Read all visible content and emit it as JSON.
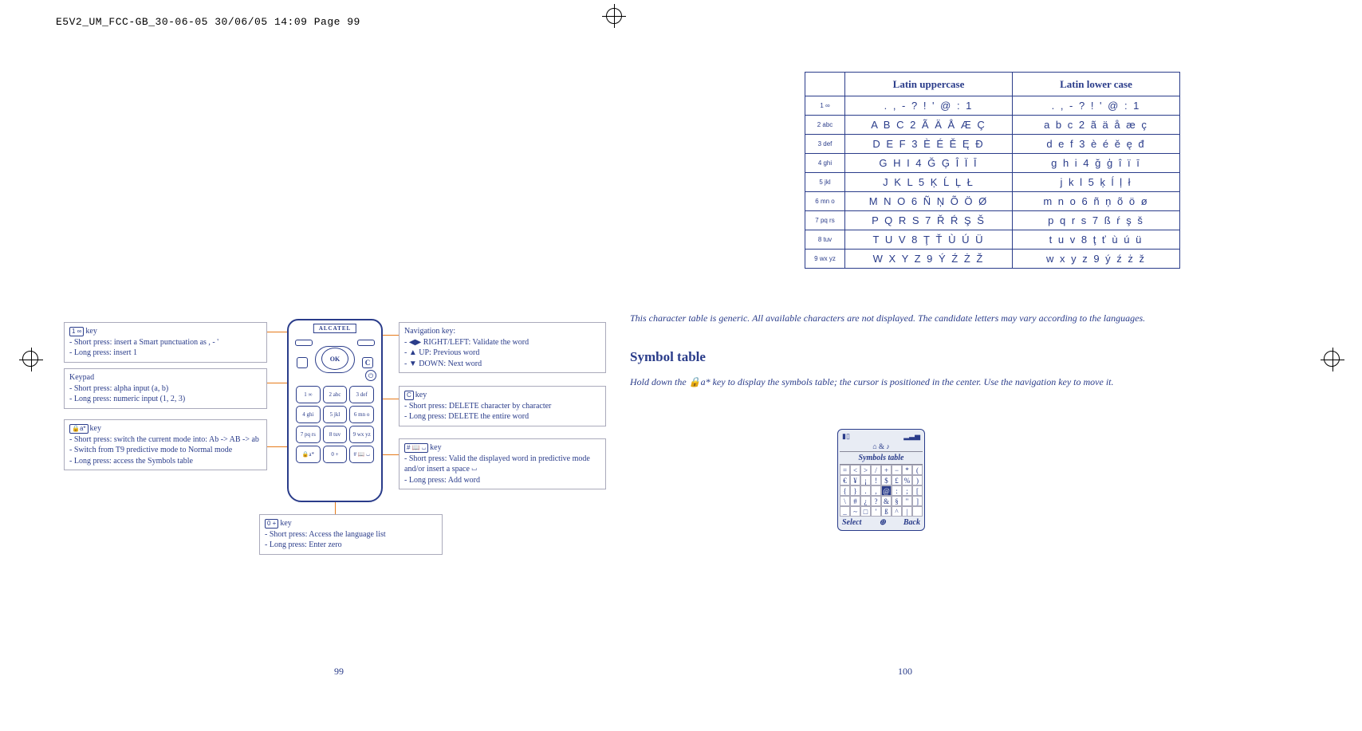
{
  "header": "E5V2_UM_FCC-GB_30-06-05  30/06/05  14:09  Page 99",
  "left_page": {
    "page_num": "99",
    "phone_brand": "ALCATEL",
    "ok_label": "OK",
    "c_label": "C",
    "end_label": "⏻",
    "keys": [
      "1 ∞",
      "2 abc",
      "3 def",
      "4 ghi",
      "5 jkl",
      "6 mn o",
      "7 pq rs",
      "8 tuv",
      "9 wx yz",
      "🔒a*",
      "0 +",
      "# 📖 ⏘"
    ],
    "c1": {
      "t": "key",
      "kg": "1 ∞",
      "l1": "Short press: insert a Smart punctuation as , - '",
      "l2": "Long press: insert 1"
    },
    "c2": {
      "t": "Keypad",
      "l1": "Short press: alpha input (a, b)",
      "l2": "Long press: numeric input (1, 2, 3)"
    },
    "c3": {
      "t": "key",
      "kg": "🔒a*",
      "l1": "Short press: switch the current mode into: Ab -> AB -> ab",
      "l2": "Switch from T9 predictive mode to Normal mode",
      "l3": "Long press: access the Symbols table"
    },
    "cr1": {
      "t": "Navigation key:",
      "l1": "◀▶ RIGHT/LEFT: Validate the word",
      "l2": "▲ UP: Previous word",
      "l3": "▼ DOWN: Next word"
    },
    "cr2": {
      "t": "key",
      "kg": "C",
      "l1": "Short press: DELETE character by character",
      "l2": "Long press: DELETE the entire word"
    },
    "cr3": {
      "t": "key",
      "kg": "# 📖 ⏘",
      "l1": "Short press: Valid the displayed word in predictive mode and/or insert a space ⏘",
      "l2": "Long press: Add word"
    },
    "cb": {
      "t": "key",
      "kg": "0 +",
      "l1": "Short press: Access the language list",
      "l2": "Long press: Enter zero"
    }
  },
  "right_page": {
    "page_num": "100",
    "th1": "Latin uppercase",
    "th2": "Latin lower case",
    "rows": [
      {
        "k": "1 ∞",
        "u": ". , - ? ! ' @ : 1",
        "l": ". , - ? ! ' @ : 1"
      },
      {
        "k": "2 abc",
        "u": "A B C 2 Ã Ä Å Æ Ç",
        "l": "a b c 2 ã ä å æ ç"
      },
      {
        "k": "3 def",
        "u": "D E F 3 È É Ě Ę Đ",
        "l": "d e f 3 è é ě ę đ"
      },
      {
        "k": "4 ghi",
        "u": "G H I 4 Ğ Ģ Î Ï Ī",
        "l": "g h i 4 ğ ģ î ï ī"
      },
      {
        "k": "5 jkl",
        "u": "J K L 5 Ķ Ĺ Ļ Ł",
        "l": "j k l 5 ķ ĺ ļ ł"
      },
      {
        "k": "6 mn o",
        "u": "M N O 6 Ñ Ņ Õ Ö Ø",
        "l": "m n o 6 ñ ņ õ ö ø"
      },
      {
        "k": "7 pq rs",
        "u": "P Q R S 7 Ř Ŕ Ş Š",
        "l": "p q r s 7 ß ŕ ş š"
      },
      {
        "k": "8 tuv",
        "u": "T U V 8 Ţ Ť Ù Ú Ü",
        "l": "t u v 8 ţ ť ù ú ü"
      },
      {
        "k": "9 wx yz",
        "u": "W X Y Z 9 Ý Ź Ż Ž",
        "l": "w x y z 9 ý ź ż ž"
      }
    ],
    "note": "This character table is generic. All available characters are not displayed. The candidate letters may vary according to the languages.",
    "heading": "Symbol table",
    "body": "Hold down the  🔒a*  key to display the symbols table; the cursor is positioned in the center. Use the navigation key to move it.",
    "screen": {
      "title": "Symbols table",
      "select": "Select",
      "back": "Back",
      "tabs": "⌂ & ♪",
      "symbols": [
        "=",
        "<",
        ">",
        "/",
        "+",
        "−",
        "*",
        "(",
        "€",
        "¥",
        "¡",
        "!",
        "$",
        "£",
        "%",
        ")",
        "{",
        "}",
        ".",
        ",",
        "@",
        ":",
        ";",
        "[",
        "\\",
        "#",
        "¿",
        "?",
        "&",
        "§",
        "\"",
        "]",
        "_",
        "~",
        "□",
        "'",
        "ß",
        "^",
        "|",
        ""
      ]
    }
  }
}
